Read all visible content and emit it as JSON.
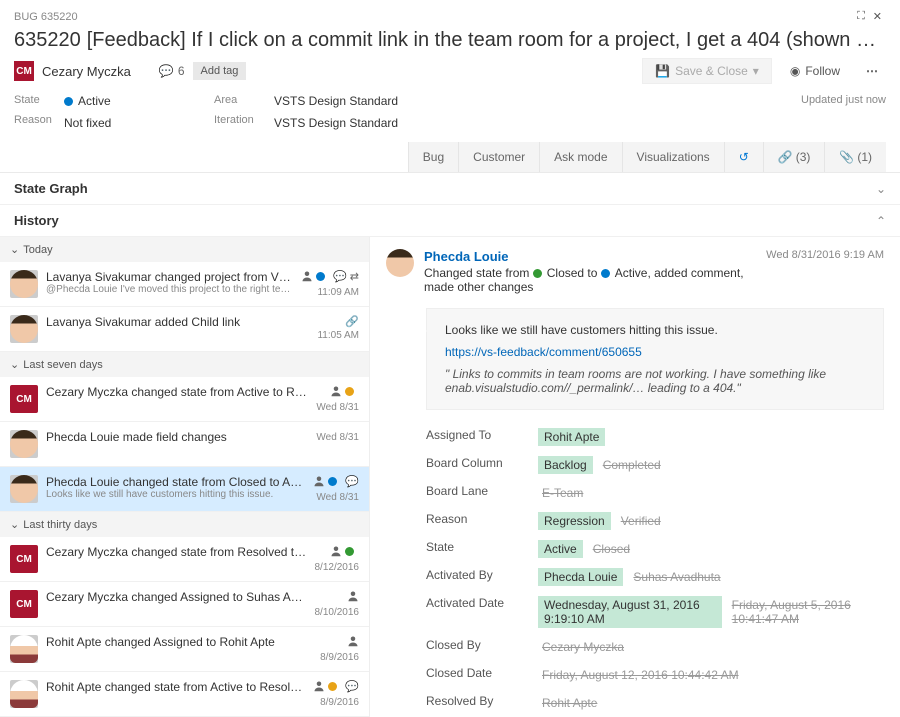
{
  "breadcrumb": "BUG 635220",
  "work_item_id": "635220",
  "title": "[Feedback] If I click on a commit link in the team room for a project, I get a 404 (shown below), does this ind",
  "assignee": {
    "initials": "CM",
    "name": "Cezary Myczka"
  },
  "comment_count": "6",
  "add_tag_label": "Add tag",
  "save_close_label": "Save & Close",
  "follow_label": "Follow",
  "updated_label": "Updated just now",
  "fields": {
    "state_label": "State",
    "state_value": "Active",
    "reason_label": "Reason",
    "reason_value": "Not fixed",
    "area_label": "Area",
    "area_value": "VSTS Design Standard",
    "iteration_label": "Iteration",
    "iteration_value": "VSTS Design Standard"
  },
  "tabs": {
    "bug": "Bug",
    "customer": "Customer",
    "ask_mode": "Ask mode",
    "visualizations": "Visualizations",
    "links_count": "(3)",
    "attach_count": "(1)"
  },
  "sections": {
    "state_graph": "State Graph",
    "history": "History"
  },
  "groups": {
    "today": "Today",
    "last7": "Last seven days",
    "last30": "Last thirty days"
  },
  "history": [
    {
      "avatar": "face",
      "text": "Lavanya Sivakumar changed project from VSO…",
      "sub": "@Phecda Louie I've moved this project to the right team an…",
      "time": "11:09 AM",
      "icons": [
        "person",
        "dot-blue",
        "comment",
        "move"
      ]
    },
    {
      "avatar": "face",
      "text": "Lavanya Sivakumar added Child link",
      "sub": "",
      "time": "11:05 AM",
      "icons": [
        "link"
      ]
    },
    {
      "avatar": "cm",
      "text": "Cezary Myczka changed state from Active to Resolve…",
      "sub": "",
      "time": "Wed 8/31",
      "icons": [
        "person",
        "dot-orange"
      ]
    },
    {
      "avatar": "face2",
      "text": "Phecda Louie made field changes",
      "sub": "",
      "time": "Wed 8/31",
      "icons": []
    },
    {
      "avatar": "face2",
      "text": "Phecda Louie changed state from Closed to Activ…",
      "sub": "Looks like we still have customers hitting this issue.",
      "time": "Wed 8/31",
      "icons": [
        "person",
        "dot-blue",
        "comment"
      ],
      "selected": true
    },
    {
      "avatar": "cm",
      "text": "Cezary Myczka changed state from Resolved to Close…",
      "sub": "",
      "time": "8/12/2016",
      "icons": [
        "person",
        "dot-green"
      ]
    },
    {
      "avatar": "cm",
      "text": "Cezary Myczka changed Assigned to Suhas Avadhuta",
      "sub": "",
      "time": "8/10/2016",
      "icons": [
        "person"
      ]
    },
    {
      "avatar": "cartoon",
      "text": "Rohit Apte changed Assigned to Rohit Apte",
      "sub": "",
      "time": "8/9/2016",
      "icons": [
        "person"
      ]
    },
    {
      "avatar": "cartoon",
      "text": "Rohit Apte changed state from Active to Resolved, m…",
      "sub": "",
      "time": "8/9/2016",
      "icons": [
        "person",
        "dot-orange",
        "comment"
      ]
    }
  ],
  "detail": {
    "name": "Phecda Louie",
    "date": "Wed 8/31/2016 9:19 AM",
    "summary_pre": "Changed state from ",
    "summary_from": "Closed",
    "summary_mid": " to ",
    "summary_to": "Active",
    "summary_post": ", added comment, made other changes",
    "comment_text": "Looks like we still have customers hitting this issue.",
    "comment_link": "https://vs-feedback/comment/650655",
    "comment_quote": "\" Links to commits in team rooms are not working.   I have something like enab.visualstudio.com//_permalink/… leading to a 404.\"",
    "changes": [
      {
        "label": "Assigned To",
        "new": "Rohit Apte",
        "old": ""
      },
      {
        "label": "Board Column",
        "new": "Backlog",
        "old": "Completed"
      },
      {
        "label": "Board Lane",
        "new": "",
        "old": "E-Team"
      },
      {
        "label": "Reason",
        "new": "Regression",
        "old": "Verified"
      },
      {
        "label": "State",
        "new": "Active",
        "old": "Closed"
      },
      {
        "label": "Activated By",
        "new": "Phecda Louie",
        "old": "Suhas Avadhuta"
      },
      {
        "label": "Activated Date",
        "new": "Wednesday, August 31, 2016 9:19:10 AM",
        "old": "Friday, August 5, 2016 10:41:47 AM"
      },
      {
        "label": "Closed By",
        "new": "",
        "old": "Cezary Myczka"
      },
      {
        "label": "Closed Date",
        "new": "",
        "old": "Friday, August 12, 2016 10:44:42 AM"
      },
      {
        "label": "Resolved By",
        "new": "",
        "old": "Rohit Apte"
      }
    ]
  }
}
